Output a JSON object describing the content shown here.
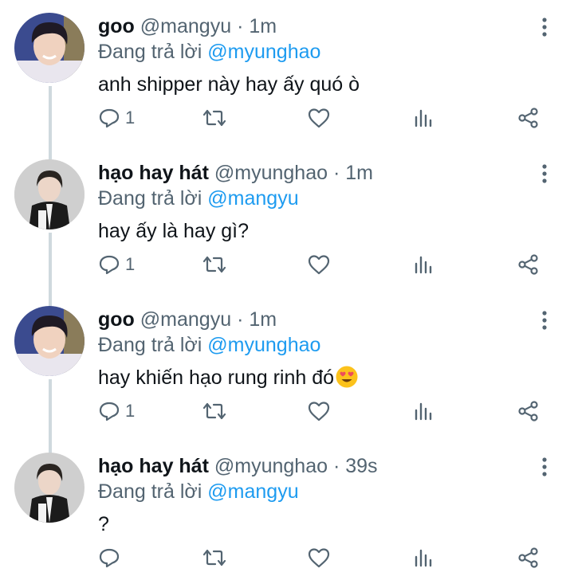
{
  "colors": {
    "text": "#0f1419",
    "secondary": "#536471",
    "mention": "#1d9bf0",
    "thread_line": "#cfd9de"
  },
  "icons": {
    "reply": "reply-icon",
    "retweet": "retweet-icon",
    "like": "heart-icon",
    "stats": "stats-icon",
    "share": "share-icon",
    "more": "more-vertical-icon"
  },
  "tweets": [
    {
      "name": "goo",
      "handle": "@mangyu",
      "sep": "·",
      "time": "1m",
      "reply_prefix": "Đang trả lời ",
      "reply_to": "@myunghao",
      "text": "anh shipper này hay ấy quó ò",
      "reply_count": "1"
    },
    {
      "name": "hạo hay hát",
      "handle": "@myunghao",
      "sep": "·",
      "time": "1m",
      "reply_prefix": "Đang trả lời ",
      "reply_to": "@mangyu",
      "text": "hay ấy là hay gì?",
      "reply_count": "1"
    },
    {
      "name": "goo",
      "handle": "@mangyu",
      "sep": "·",
      "time": "1m",
      "reply_prefix": "Đang trả lời ",
      "reply_to": "@myunghao",
      "text": "hay khiến hạo rung rinh đó",
      "emoji": "smiling-face-with-heart-eyes",
      "reply_count": "1"
    },
    {
      "name": "hạo hay hát",
      "handle": "@myunghao",
      "sep": "·",
      "time": "39s",
      "reply_prefix": "Đang trả lời ",
      "reply_to": "@mangyu",
      "text": "?",
      "reply_count": ""
    }
  ]
}
